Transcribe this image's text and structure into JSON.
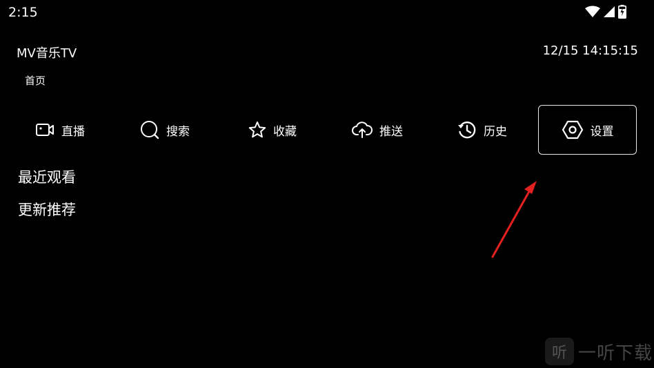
{
  "status_bar": {
    "time": "2:15"
  },
  "header": {
    "app_title": "MV音乐TV",
    "datetime": "12/15 14:15:15",
    "breadcrumb": "首页"
  },
  "tabs": [
    {
      "label": "直播",
      "icon": "video-camera-icon"
    },
    {
      "label": "搜索",
      "icon": "search-icon"
    },
    {
      "label": "收藏",
      "icon": "star-icon"
    },
    {
      "label": "推送",
      "icon": "cloud-upload-icon"
    },
    {
      "label": "历史",
      "icon": "history-icon"
    },
    {
      "label": "设置",
      "icon": "settings-hexagon-icon",
      "selected": true
    }
  ],
  "sections": [
    {
      "label": "最近观看"
    },
    {
      "label": "更新推荐"
    }
  ],
  "annotation": {
    "color": "#e52020"
  },
  "watermark": {
    "logo": "听",
    "text": "一听下载"
  }
}
